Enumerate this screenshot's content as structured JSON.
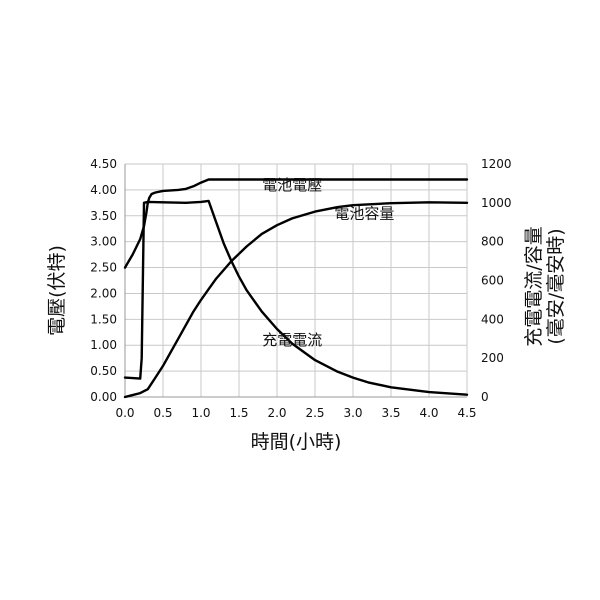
{
  "chart_data": {
    "type": "line",
    "xlabel": "時間(小時)",
    "ylabel_left": "電壓(伏特)",
    "ylabel_right": "充電電流/容量",
    "ylabel_right_unit": "(毫安/毫安時)",
    "xlim": [
      0,
      4.5
    ],
    "ylim_left": [
      0,
      4.5
    ],
    "ylim_right": [
      0,
      1200
    ],
    "x_ticks": [
      "0.0",
      "0.5",
      "1.0",
      "1.5",
      "2.0",
      "2.5",
      "3.0",
      "3.5",
      "4.0",
      "4.5"
    ],
    "y_ticks_left": [
      "0.00",
      "0.50",
      "1.00",
      "1.50",
      "2.00",
      "2.50",
      "3.00",
      "3.50",
      "4.00",
      "4.50"
    ],
    "y_ticks_right": [
      "0",
      "200",
      "400",
      "600",
      "800",
      "1000",
      "1200"
    ],
    "grid": true,
    "series": [
      {
        "name": "電池電壓",
        "axis": "left",
        "x": [
          0.0,
          0.1,
          0.2,
          0.25,
          0.28,
          0.3,
          0.32,
          0.35,
          0.4,
          0.5,
          0.6,
          0.7,
          0.8,
          0.9,
          1.0,
          1.1,
          1.2,
          1.5,
          2.0,
          3.0,
          4.0,
          4.5
        ],
        "y": [
          2.5,
          2.75,
          3.05,
          3.3,
          3.55,
          3.75,
          3.85,
          3.92,
          3.95,
          3.98,
          3.99,
          4.0,
          4.02,
          4.07,
          4.14,
          4.2,
          4.2,
          4.2,
          4.2,
          4.2,
          4.2,
          4.2
        ]
      },
      {
        "name": "電池容量",
        "axis": "right",
        "x": [
          0.0,
          0.1,
          0.2,
          0.3,
          0.4,
          0.5,
          0.6,
          0.7,
          0.8,
          0.9,
          1.0,
          1.1,
          1.2,
          1.4,
          1.6,
          1.8,
          2.0,
          2.2,
          2.5,
          2.8,
          3.0,
          3.5,
          4.0,
          4.5
        ],
        "y": [
          0,
          10,
          20,
          40,
          100,
          160,
          230,
          300,
          370,
          440,
          500,
          555,
          610,
          700,
          775,
          840,
          885,
          920,
          955,
          978,
          988,
          998,
          1003,
          1000
        ]
      },
      {
        "name": "充電電流",
        "axis": "right",
        "x": [
          0.0,
          0.2,
          0.22,
          0.25,
          0.3,
          0.5,
          0.8,
          1.0,
          1.1,
          1.2,
          1.3,
          1.4,
          1.5,
          1.6,
          1.8,
          2.0,
          2.2,
          2.5,
          2.8,
          3.0,
          3.2,
          3.5,
          4.0,
          4.5
        ],
        "y": [
          100,
          95,
          200,
          1000,
          1005,
          1003,
          1000,
          1005,
          1010,
          900,
          790,
          700,
          620,
          550,
          440,
          350,
          275,
          190,
          130,
          100,
          75,
          50,
          25,
          12
        ]
      }
    ],
    "annotations": [
      {
        "text": "電池電壓",
        "x": 2.2,
        "y_axis": "left",
        "y": 4.0
      },
      {
        "text": "電池容量",
        "x": 3.15,
        "y_axis": "left",
        "y": 3.45
      },
      {
        "text": "充電電流",
        "x": 2.2,
        "y_axis": "left",
        "y": 1.0
      }
    ]
  }
}
